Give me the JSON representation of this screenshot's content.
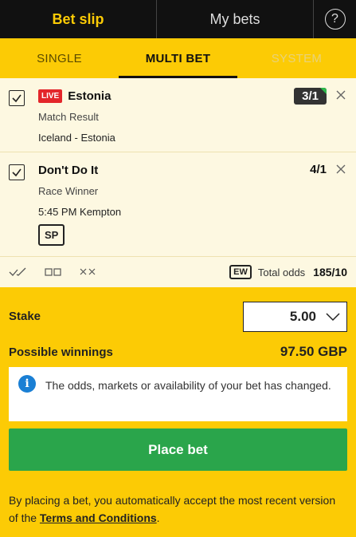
{
  "header": {
    "tab_betslip": "Bet slip",
    "tab_mybets": "My bets",
    "help": "?"
  },
  "bet_types": {
    "single": "SINGLE",
    "multi": "MULTI BET",
    "system": "SYSTEM"
  },
  "bets": [
    {
      "live": "LIVE",
      "name": "Estonia",
      "odds": "3/1",
      "market": "Match Result",
      "event": "Iceland - Estonia"
    },
    {
      "name": "Don't Do It",
      "odds": "4/1",
      "market": "Race Winner",
      "event": "5:45 PM Kempton",
      "price_type": "SP"
    }
  ],
  "toolbar": {
    "ew": "EW",
    "total_odds_label": "Total odds",
    "total_odds_value": "185/10"
  },
  "stake": {
    "label": "Stake",
    "value": "5.00"
  },
  "winnings": {
    "label": "Possible winnings",
    "value": "97.50 GBP"
  },
  "notice": {
    "icon": "i",
    "message": "The odds, markets or availability of your bet has changed."
  },
  "place_bet": "Place bet",
  "footer": {
    "text_before": "By placing a bet, you automatically accept the most recent version of the ",
    "terms_link": "Terms and Conditions",
    "text_after": "."
  },
  "colors": {
    "brand_yellow": "#fccb05",
    "header_black": "#111111",
    "live_red": "#e3262b",
    "place_green": "#2aa54b",
    "info_blue": "#1a7fd4"
  }
}
